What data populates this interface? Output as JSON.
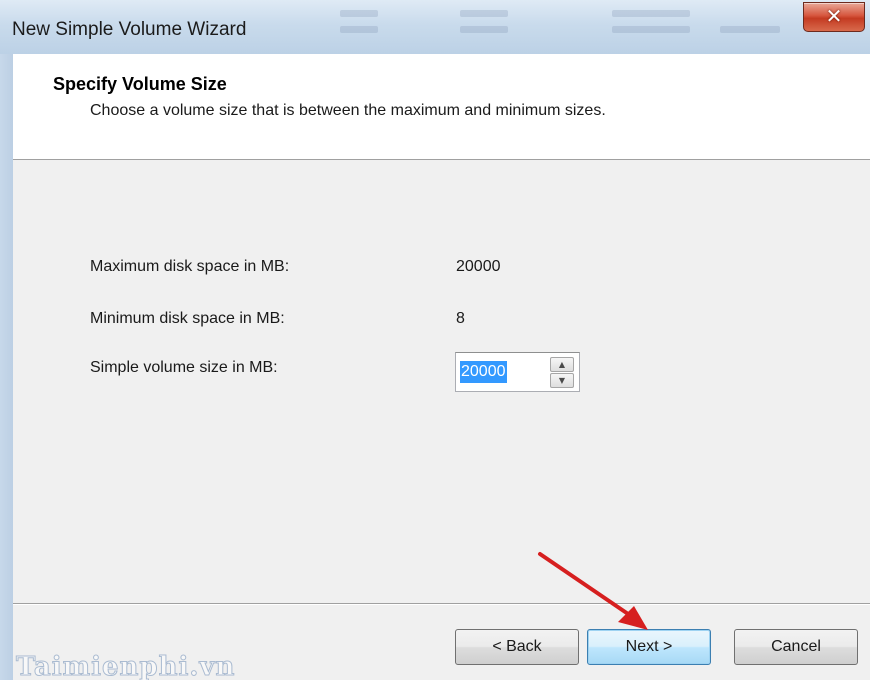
{
  "window": {
    "title": "New Simple Volume Wizard",
    "close_glyph": "✕"
  },
  "header": {
    "title": "Specify Volume Size",
    "subtitle": "Choose a volume size that is between the maximum and minimum sizes."
  },
  "fields": {
    "max_label": "Maximum disk space in MB:",
    "max_value": "20000",
    "min_label": "Minimum disk space in MB:",
    "min_value": "8",
    "size_label": "Simple volume size in MB:",
    "size_value": "20000"
  },
  "icons": {
    "spin_up": "▲",
    "spin_down": "▼"
  },
  "buttons": {
    "back": "< Back",
    "next": "Next >",
    "cancel": "Cancel"
  },
  "watermark": "Taimienphi.vn",
  "colors": {
    "selection": "#3399ff",
    "annotation_arrow": "#d61f1f",
    "close_button": "#c43b22"
  }
}
